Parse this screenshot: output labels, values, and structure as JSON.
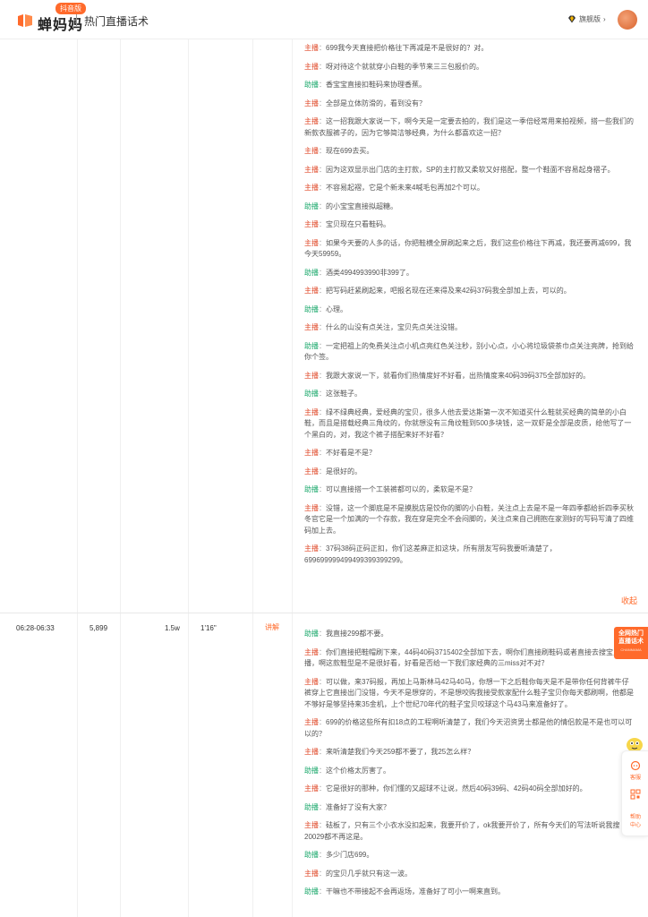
{
  "header": {
    "logo_text": "蝉妈妈",
    "version_badge": "抖音版",
    "page_title": "热门直播话术",
    "vip_label": "旗舰版"
  },
  "row2": {
    "time": "06:28-06:33",
    "views": "5,899",
    "gmv": "1.5w",
    "duration": "1'16\"",
    "explain": "讲解"
  },
  "collapse_label": "收起",
  "promo": {
    "line1": "全网热门",
    "line2": "直播话术",
    "small": "CHANMAMA"
  },
  "side": {
    "service": "客服",
    "help_1": "帮助",
    "help_2": "中心"
  },
  "roles": {
    "host": "主播",
    "assist": "助播"
  },
  "script_top": [
    {
      "role": "host",
      "text": "699我今天直接把价格往下再减是不是很好的？对。"
    },
    {
      "role": "host",
      "text": "呀对待这个就就穿小白鞋的季节来三三包报价的。"
    },
    {
      "role": "assist",
      "text": "香宝宝直接扣鞋码来协理香蕉。"
    },
    {
      "role": "host",
      "text": "全部是立体防滑的，看到没有？"
    },
    {
      "role": "host",
      "text": "这一招我跟大家说一下，啊今天是一定要去拍的，我们是这一季倍经常用来拍视频，搭一些我们的新款衣服裤子的，因为它够简洁够经典，为什么都喜欢这一招？"
    },
    {
      "role": "host",
      "text": "现在699去买。"
    },
    {
      "role": "host",
      "text": "因为这双显示出门店的主打款，SP的主打款又柔软又好搭配，整一个鞋面不容易起身褶子。"
    },
    {
      "role": "host",
      "text": "不容易起褶，它是个新未来4喊毛包再加2个可以。"
    },
    {
      "role": "assist",
      "text": "的小宝宝直接拟超糖。"
    },
    {
      "role": "host",
      "text": "宝贝现在只看鞋码。"
    },
    {
      "role": "host",
      "text": "如果今天要的人多的话，你把鞋横全屏刷起来之后，我们这些价格往下再减，我还要再减699，我今天59959。"
    },
    {
      "role": "assist",
      "text": "酒类4994993990非399了。"
    },
    {
      "role": "host",
      "text": "把写码赶紧刷起来，吧报名现在还来得及来42码37码我全部加上去，可以的。"
    },
    {
      "role": "assist",
      "text": "心理。"
    },
    {
      "role": "host",
      "text": "什么的山没有点关注，宝贝先点关注没错。"
    },
    {
      "role": "assist",
      "text": "一定把祖上的免费关注点小机点亮红色关注秒，别小心点，小心将垃圾袋茶巾点关注亮牌，抢到给你个签。"
    },
    {
      "role": "host",
      "text": "我跟大家说一下，就看你们热情度好不好看，出热情度来40码39码375全部加好的。"
    },
    {
      "role": "assist",
      "text": "这张鞋子。"
    },
    {
      "role": "host",
      "text": "绿不绿典经典，爱经典的宝贝，很多人他去爱达斯第一次不知道买什么鞋就买经典的简单的小白鞋，而且是搭载经典三角纹的，你就想没有三角纹鞋到500多块钱，这一双虾是全部是皮质，给他写了一个黑白的，对，我这个裤子搭配来好不好看？"
    },
    {
      "role": "host",
      "text": "不好看是不是？"
    },
    {
      "role": "host",
      "text": "是很好的。"
    },
    {
      "role": "assist",
      "text": "可以直接搭一个工装裤都可以的，柔软是不是？"
    },
    {
      "role": "host",
      "text": "没错，这一个脚底是不是摸脱店是饺你的脚的小白鞋，关注点上去是不是一年四季都给折四季买秋冬官它是一个加满的一个存款，我在穿是完全不会闷脚的，关注点来自己拥抱在家测好的写码写清了四维码加上去。"
    },
    {
      "role": "host",
      "text": "37码38码正码正扣，你们这差麻正扣这块，所有朋友写码我要听清楚了，699699999499499399399299。"
    }
  ],
  "script_bottom": [
    {
      "role": "assist",
      "text": "我直接299都不要。"
    },
    {
      "role": "host",
      "text": "你们直接把鞋帽刷下来，44码40码3715402全部加下去，啊你们直接刷鞋码或者直接去搜宝贝直播，啊这款鞋型是不是很好看，好看是否给一下我们家经典的三miss对不对？"
    },
    {
      "role": "host",
      "text": "可以做，来37码报，再加上马斯林马42马40马，你想一下之后鞋你每天是不是带你任何背裤牛仔裤穿上它直接出门没错，今天不是想穿的，不是想咬购我接受款家配什么鞋子宝贝你每天都刷啊，他都是不够好是够坚持来35金机，上个世纪70年代的鞋子宝贝咬球这个马43马来准备好了。"
    },
    {
      "role": "host",
      "text": "699的价格这些所有扣18点的工程啊听清楚了，我们今天沼资男士都是他的情侣款是不是也可以可以的？"
    },
    {
      "role": "host",
      "text": "来听清楚我们今天259都不要了，我25怎么样？"
    },
    {
      "role": "assist",
      "text": "这个价格太厉害了。"
    },
    {
      "role": "host",
      "text": "它是很好的那种，你们懂的又超球不让说，然后40码39码、42码40码全部加好的。"
    },
    {
      "role": "assist",
      "text": "准备好了没有大家？"
    },
    {
      "role": "host",
      "text": "砝板了，只有三个小衣水没扣起来，我要开价了，ok我要开价了，所有今天们的写法听说我搜20029都不再这是。"
    },
    {
      "role": "assist",
      "text": "多少门店699。"
    },
    {
      "role": "host",
      "text": "的宝贝几乎就只有这一波。"
    },
    {
      "role": "assist",
      "text": "干嘛也不带接起不会再返场，准备好了可小一啊来直到。"
    }
  ]
}
